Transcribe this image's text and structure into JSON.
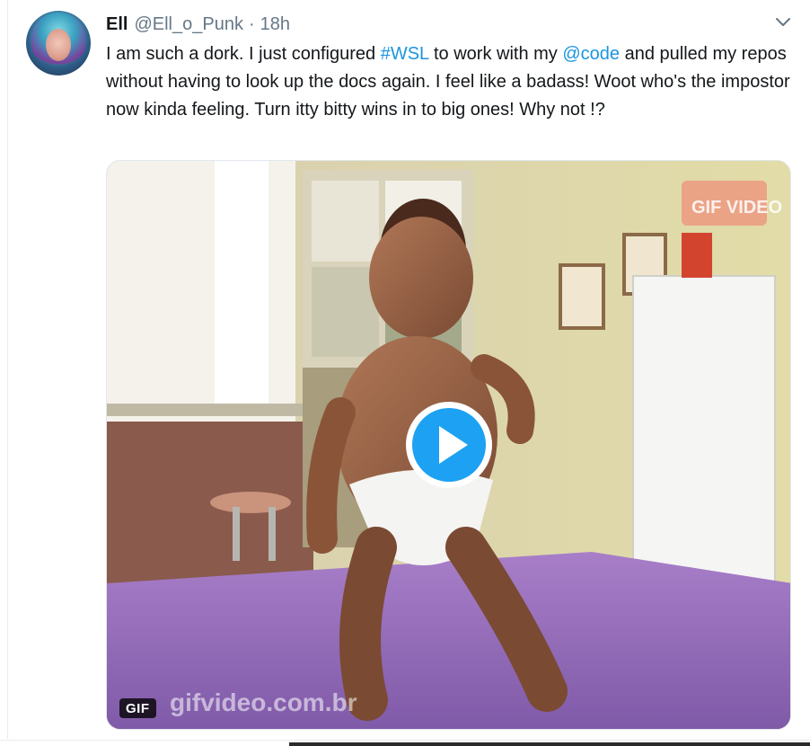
{
  "tweet": {
    "display_name": "Ell",
    "handle": "@Ell_o_Punk",
    "separator": "·",
    "time": "18h",
    "text_parts": {
      "p1": "I am such a dork. I just configured ",
      "hashtag": "#WSL",
      "p2": " to work with my ",
      "mention": "@code",
      "p3": " and pulled my repos without having to look up the docs again. I feel like a badass! Woot who's the impostor now kinda feeling. Turn itty bitty wins in to big ones! Why not !?"
    }
  },
  "media": {
    "type_badge": "GIF",
    "watermark_top": "GIF VIDEO",
    "watermark_bottom": "gifvideo.com.br",
    "play_icon": "play-icon"
  },
  "icons": {
    "chevron": "chevron-down-icon"
  },
  "colors": {
    "link": "#1b95e0",
    "text": "#14171a",
    "muted": "#657786",
    "play_blue": "#1da1f2"
  }
}
